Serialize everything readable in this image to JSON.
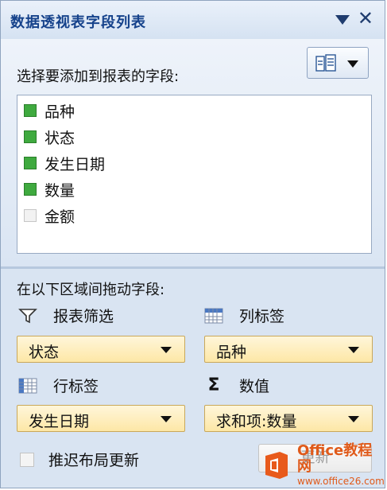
{
  "title": "数据透视表字段列表",
  "prompt": "选择要添加到报表的字段:",
  "fields": [
    {
      "label": "品种",
      "checked": true
    },
    {
      "label": "状态",
      "checked": true
    },
    {
      "label": "发生日期",
      "checked": true
    },
    {
      "label": "数量",
      "checked": true
    },
    {
      "label": "金额",
      "checked": false
    }
  ],
  "drag_prompt": "在以下区域间拖动字段:",
  "areas": {
    "filter": {
      "label": "报表筛选",
      "value": "状态",
      "icon": "filter-icon"
    },
    "columns": {
      "label": "列标签",
      "value": "品种",
      "icon": "column-grid-icon"
    },
    "rows": {
      "label": "行标签",
      "value": "发生日期",
      "icon": "row-grid-icon"
    },
    "values": {
      "label": "数值",
      "value": "求和项:数量",
      "icon": "sigma-icon"
    }
  },
  "defer_label": "推迟布局更新",
  "update_label": "更新",
  "watermark": {
    "main": "Office教程网",
    "sub": "www.office26.com"
  },
  "colors": {
    "title": "#15428b",
    "checked": "#3faa3f",
    "panel": "#d9e4f2",
    "combo": "#fde7a6"
  }
}
